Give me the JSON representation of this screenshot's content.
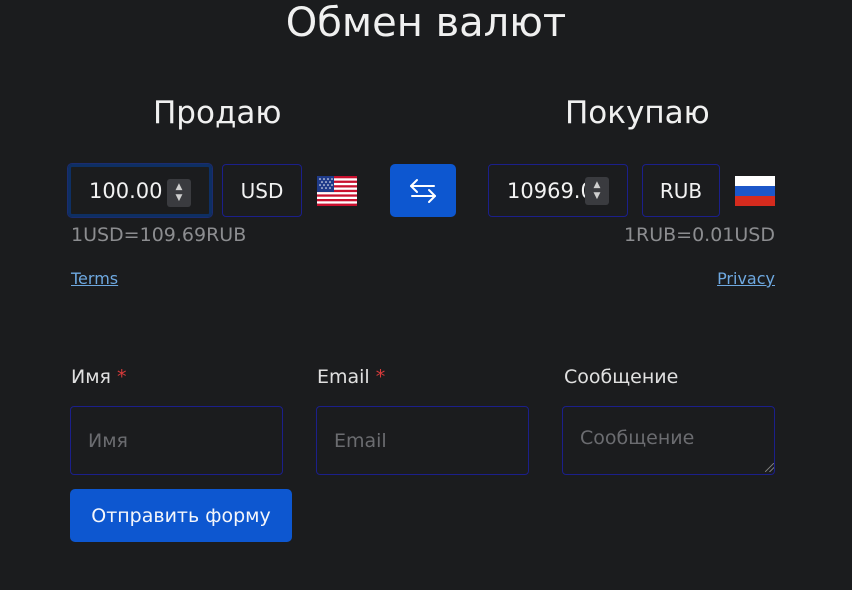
{
  "header": {
    "title": "Обмен валют"
  },
  "sell": {
    "heading": "Продаю",
    "amount": "100.00",
    "currency": "USD",
    "flag_icon": "us-flag-icon",
    "rate": "1USD=109.69RUB",
    "link": "Terms"
  },
  "buy": {
    "heading": "Покупаю",
    "amount": "10969.0",
    "currency": "RUB",
    "flag_icon": "ru-flag-icon",
    "rate": "1RUB=0.01USD",
    "link": "Privacy"
  },
  "swap": {
    "icon": "swap-arrows-icon",
    "color": "#0d57d0"
  },
  "form": {
    "name": {
      "label": "Имя",
      "required_mark": "*",
      "placeholder": "Имя"
    },
    "email": {
      "label": "Email",
      "required_mark": "*",
      "placeholder": "Email"
    },
    "message": {
      "label": "Сообщение",
      "placeholder": "Сообщение"
    },
    "submit_label": "Отправить форму"
  },
  "colors": {
    "background": "#1b1c1e",
    "accent": "#0d57d0",
    "border": "#1b1f8a",
    "link": "#6ea8e0",
    "required": "#d83b3b"
  }
}
